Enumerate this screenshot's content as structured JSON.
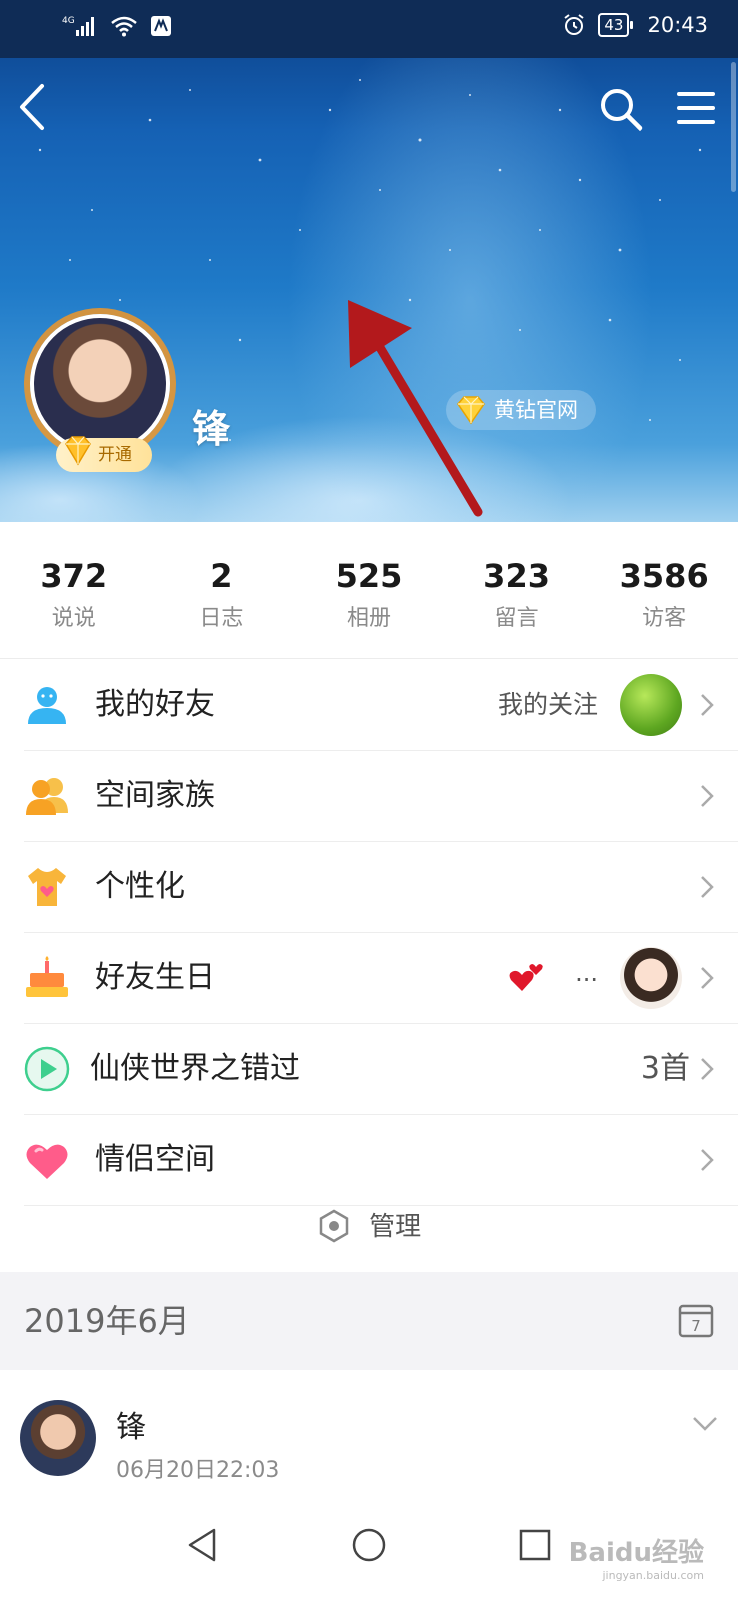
{
  "status_bar": {
    "network": "4G",
    "battery": "43",
    "time": "20:43"
  },
  "profile": {
    "name": "锋",
    "open_badge": "开通",
    "yellow_diamond_site": "黄钻官网"
  },
  "stats": [
    {
      "value": "372",
      "label": "说说"
    },
    {
      "value": "2",
      "label": "日志"
    },
    {
      "value": "525",
      "label": "相册"
    },
    {
      "value": "323",
      "label": "留言"
    },
    {
      "value": "3586",
      "label": "访客"
    }
  ],
  "menu": {
    "friends": {
      "label": "我的好友",
      "extra": "我的关注"
    },
    "family": {
      "label": "空间家族"
    },
    "personalize": {
      "label": "个性化"
    },
    "birthday": {
      "label": "好友生日",
      "dots": "..."
    },
    "music": {
      "label": "仙侠世界之错过",
      "count": "3首"
    },
    "couple": {
      "label": "情侣空间"
    }
  },
  "manage": {
    "label": "管理"
  },
  "date_section": {
    "label": "2019年6月",
    "calendar_day": "7"
  },
  "post": {
    "author": "锋",
    "time": "06月20日22:03"
  },
  "watermark": {
    "brand": "Baidu经验",
    "url": "jingyan.baidu.com"
  },
  "colors": {
    "annotation_arrow": "#b3191c",
    "friends_icon": "#36b4f2",
    "family_icon": "#f7a224",
    "music_icon": "#3ecf8e",
    "heart_icon": "#ff5c8a"
  },
  "icons": [
    "back-icon",
    "search-icon",
    "menu-icon",
    "alarm-icon",
    "calendar-icon",
    "hexagon-icon",
    "chevron-right-icon",
    "chevron-down-icon"
  ]
}
